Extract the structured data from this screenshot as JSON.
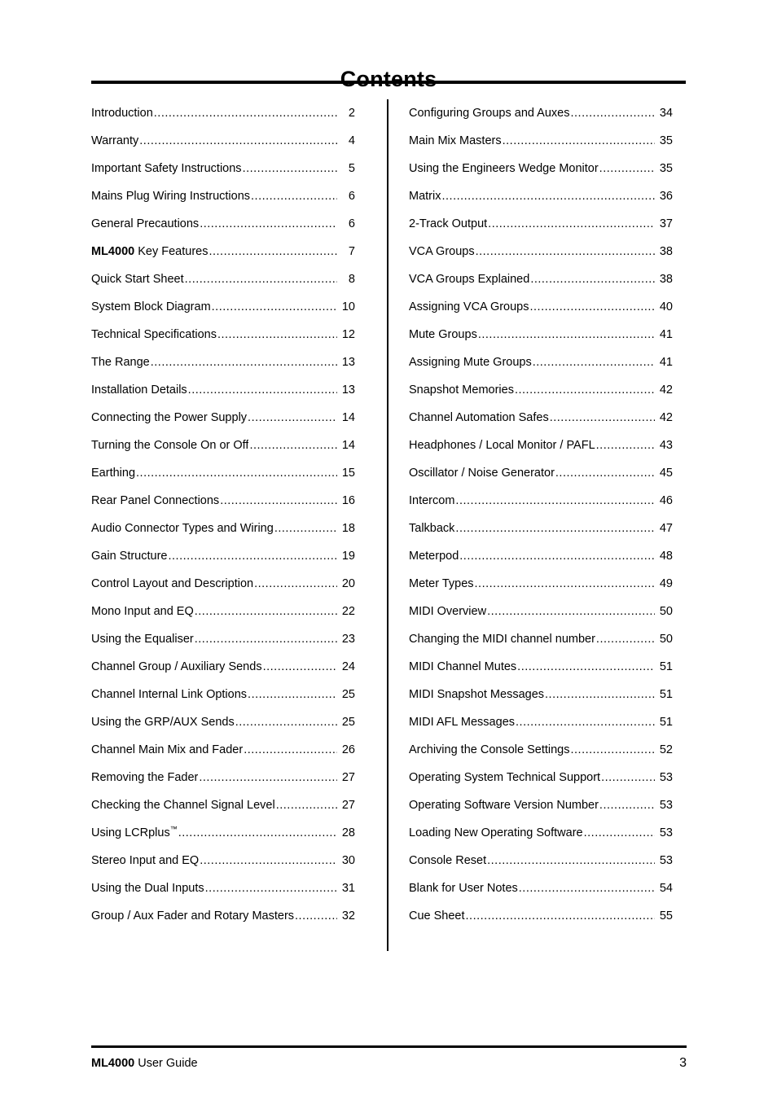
{
  "document": {
    "title": "Contents"
  },
  "toc": {
    "left_column": [
      {
        "label": "Introduction",
        "page": "2"
      },
      {
        "label": "Warranty",
        "page": "4"
      },
      {
        "label": "Important Safety Instructions",
        "page": "5"
      },
      {
        "label": "Mains Plug Wiring Instructions",
        "page": "6"
      },
      {
        "label": "General Precautions",
        "page": "6"
      },
      {
        "label": "ML4000 Key Features",
        "page": "7",
        "bold_prefix": "ML4000"
      },
      {
        "label": "Quick Start Sheet",
        "page": "8"
      },
      {
        "label": "System Block Diagram",
        "page": "10"
      },
      {
        "label": "Technical Specifications",
        "page": "12"
      },
      {
        "label": "The Range",
        "page": "13"
      },
      {
        "label": "Installation Details",
        "page": "13"
      },
      {
        "label": "Connecting the Power Supply",
        "page": "14"
      },
      {
        "label": "Turning the Console On or Off",
        "page": "14"
      },
      {
        "label": "Earthing",
        "page": "15"
      },
      {
        "label": "Rear Panel Connections",
        "page": "16"
      },
      {
        "label": "Audio Connector Types and Wiring",
        "page": "18"
      },
      {
        "label": "Gain Structure",
        "page": "19"
      },
      {
        "label": "Control Layout and Description",
        "page": "20"
      },
      {
        "label": "Mono Input and EQ",
        "page": "22"
      },
      {
        "label": "Using the Equaliser",
        "page": "23"
      },
      {
        "label": "Channel Group / Auxiliary Sends",
        "page": "24"
      },
      {
        "label": "Channel Internal Link Options",
        "page": "25"
      },
      {
        "label": "Using the GRP/AUX Sends",
        "page": "25"
      },
      {
        "label": "Channel Main Mix and Fader",
        "page": "26"
      },
      {
        "label": "Removing the Fader",
        "page": "27"
      },
      {
        "label": "Checking the Channel Signal Level",
        "page": "27"
      },
      {
        "label": "Using LCRplus™",
        "page": "28",
        "trademark_suffix": "™"
      },
      {
        "label": "Stereo Input and EQ",
        "page": "30"
      },
      {
        "label": "Using the Dual Inputs",
        "page": "31"
      },
      {
        "label": "Group / Aux Fader and Rotary Masters",
        "page": "32"
      }
    ],
    "right_column": [
      {
        "label": "Configuring Groups and Auxes",
        "page": "34"
      },
      {
        "label": "Main Mix Masters",
        "page": "35"
      },
      {
        "label": "Using the Engineers Wedge Monitor",
        "page": "35"
      },
      {
        "label": "Matrix",
        "page": "36"
      },
      {
        "label": "2-Track Output",
        "page": "37"
      },
      {
        "label": "VCA Groups",
        "page": "38"
      },
      {
        "label": "VCA Groups Explained",
        "page": "38"
      },
      {
        "label": "Assigning VCA Groups",
        "page": "40"
      },
      {
        "label": "Mute Groups",
        "page": "41"
      },
      {
        "label": "Assigning Mute Groups",
        "page": "41"
      },
      {
        "label": "Snapshot Memories",
        "page": "42"
      },
      {
        "label": "Channel Automation Safes",
        "page": "42"
      },
      {
        "label": "Headphones / Local Monitor / PAFL",
        "page": "43"
      },
      {
        "label": "Oscillator / Noise Generator",
        "page": "45"
      },
      {
        "label": "Intercom",
        "page": "46"
      },
      {
        "label": "Talkback",
        "page": "47"
      },
      {
        "label": "Meterpod",
        "page": "48"
      },
      {
        "label": "Meter Types",
        "page": "49"
      },
      {
        "label": "MIDI Overview",
        "page": "50"
      },
      {
        "label": "Changing the MIDI channel number",
        "page": "50"
      },
      {
        "label": "MIDI Channel Mutes",
        "page": "51"
      },
      {
        "label": "MIDI Snapshot Messages",
        "page": "51"
      },
      {
        "label": "MIDI AFL Messages",
        "page": "51"
      },
      {
        "label": "Archiving the Console Settings",
        "page": "52"
      },
      {
        "label": "Operating System Technical Support",
        "page": "53"
      },
      {
        "label": "Operating Software Version Number",
        "page": "53"
      },
      {
        "label": "Loading New Operating Software",
        "page": "53"
      },
      {
        "label": "Console Reset",
        "page": "53"
      },
      {
        "label": "Blank for User Notes",
        "page": "54"
      },
      {
        "label": "Cue Sheet",
        "page": "55"
      }
    ]
  },
  "footer": {
    "product": "ML4000",
    "guide_text": " User Guide",
    "page_number": "3"
  }
}
